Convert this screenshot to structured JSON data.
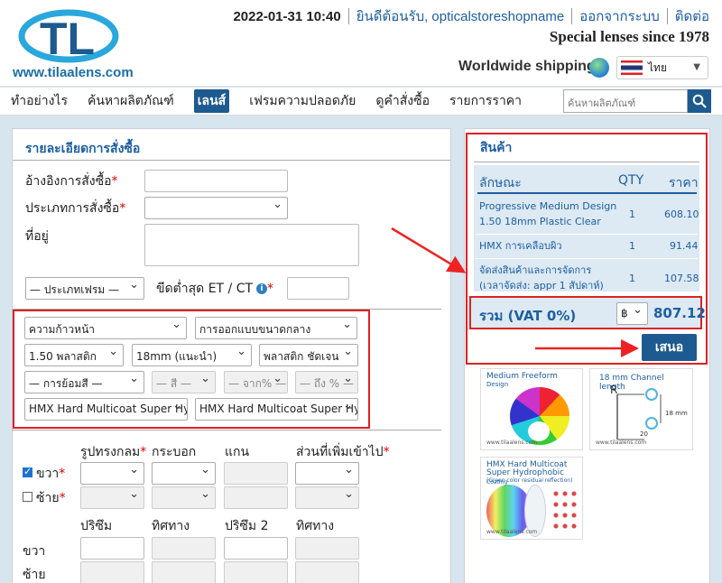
{
  "header": {
    "datetime": "2022-01-31 10:40",
    "welcome": "ยินดีต้อนรับ, opticalstoreshopname",
    "logout": "ออกจากระบบ",
    "contact": "ติดต่อ",
    "tagline": "Special lenses since 1978",
    "shipping": "Worldwide shipping",
    "language": "ไทย",
    "logo_url": "www.tilaalens.com"
  },
  "nav": {
    "items": [
      "ทำอย่างไร",
      "ค้นหาผลิตภัณฑ์",
      "เลนส์",
      "เฟรมความปลอดภัย",
      "ดูคำสั่งซื้อ",
      "รายการราคา"
    ],
    "active_index": 2,
    "search_placeholder": "ค้นหาผลิตภัณฑ์"
  },
  "order": {
    "title": "รายละเอียดการสั่งซื้อ",
    "reference_label": "อ้างอิงการสั่งซื้อ",
    "type_label": "ประเภทการสั่งซื้อ",
    "address_label": "ที่อยู่",
    "frame_type": "— ประเภทเฟรม —",
    "min_thickness_label": "ขีดต่ำสุด ET / CT",
    "lens": {
      "progress": "ความก้าวหน้า",
      "design": "การออกแบบขนาดกลาง",
      "material": "1.50 พลาสติก",
      "channel": "18mm (แนะนำ)",
      "finish": "พลาสติก ชัดเจน",
      "tint": "— การย้อมสี —",
      "color": "— สี —",
      "from": "— จาก% —",
      "to": "— ถึง % —",
      "coating1": "HMX Hard Multicoat Super Hyd",
      "coating2": "HMX Hard Multicoat Super Hyd"
    },
    "rx": {
      "col_shape": "รูปทรงกลม",
      "col_cylinder": "กระบอก",
      "col_axis": "แกน",
      "col_add": "ส่วนที่เพิ่มเข้าไป",
      "right": "ขวา",
      "left": "ซ้าย",
      "prism": "ปริซึม",
      "direction": "ทิศทาง",
      "prism2": "ปริซึม 2",
      "direction2": "ทิศทาง",
      "right_plain": "ขวา",
      "left_plain": "ซ้าย",
      "right_checked": true,
      "left_checked": false
    }
  },
  "cart": {
    "title": "สินค้า",
    "col_feature": "ลักษณะ",
    "col_qty": "QTY",
    "col_price": "ราคา",
    "rows": [
      {
        "desc1": "Progressive Medium Design",
        "desc2": "1.50 18mm Plastic Clear",
        "qty": "1",
        "price": "608.10"
      },
      {
        "desc1": "HMX การเคลือบผิว",
        "desc2": "",
        "qty": "1",
        "price": "91.44"
      },
      {
        "desc1": "จัดส่งสินค้าและการจัดการ",
        "desc2": "(เวลาจัดส่ง: appr 1 สัปดาห์)",
        "qty": "1",
        "price": "107.58"
      }
    ],
    "total_label": "รวม (VAT 0%)",
    "currency": "฿",
    "total": "807.12",
    "submit": "เสนอ"
  },
  "thumbs": {
    "freeform_title": "Medium Freeform",
    "freeform_sub": "Design",
    "channel_title": "18 mm Channel length",
    "channel_r": "R",
    "channel_18": "18 mm",
    "channel_20": "20",
    "hmx_title1": "HMX Hard Multicoat",
    "hmx_title2": "Super Hydrophobic",
    "hmx_coating": "Coating",
    "hmx_sub": "(Green color residual reflection)",
    "footer": "www.tilaalens.com"
  },
  "colors": {
    "brand": "#1d5a8f",
    "link": "#1d5fa0",
    "highlight": "#dd2222",
    "panel_bg": "#d7e6ee"
  }
}
